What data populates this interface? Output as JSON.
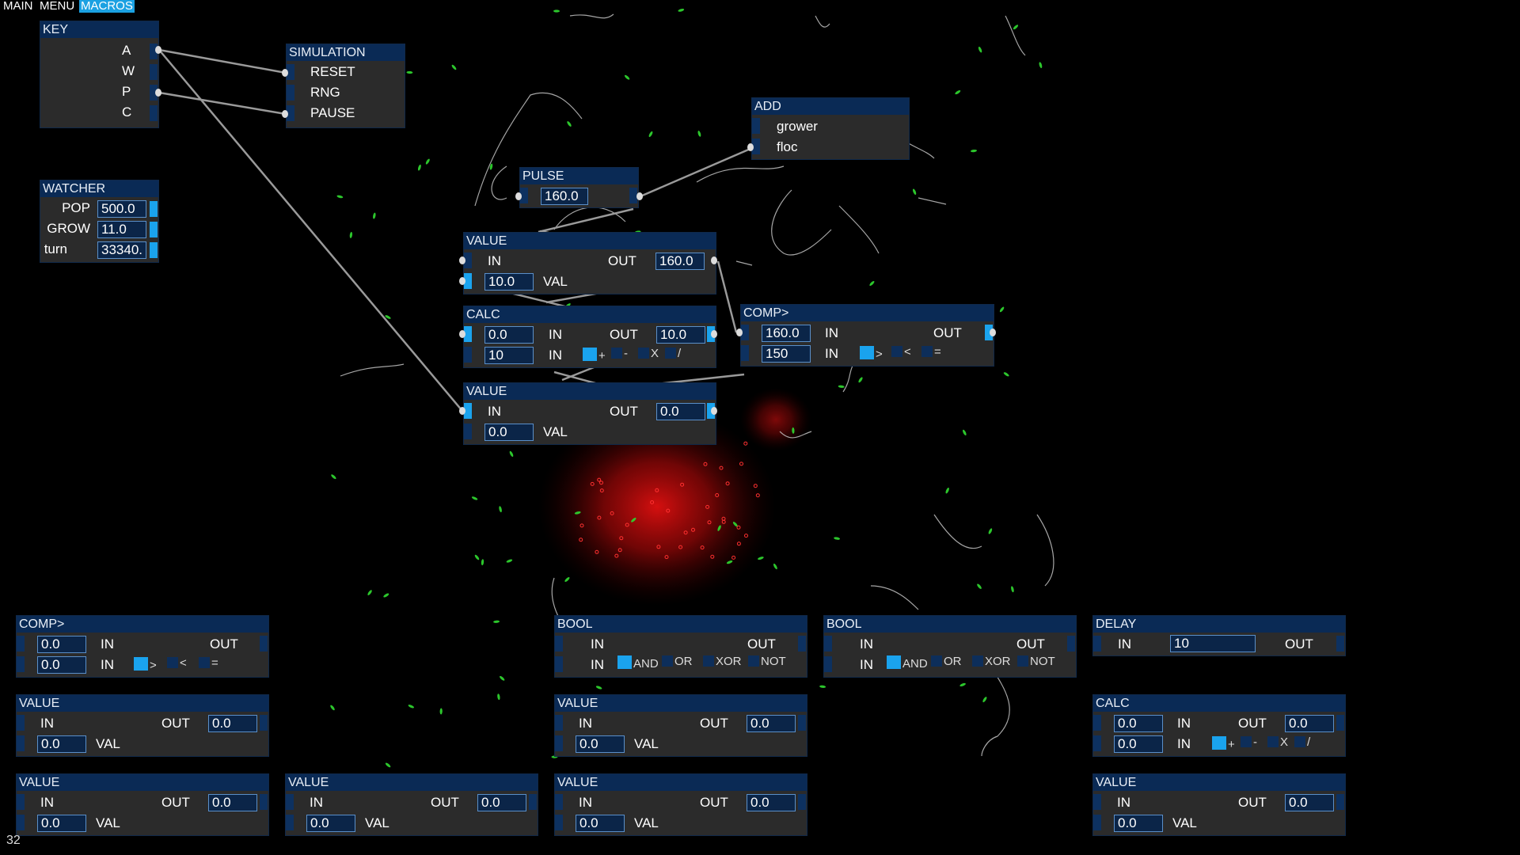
{
  "menu_bar": {
    "items": [
      "MAIN",
      "MENU",
      "MACROS"
    ],
    "active_item": "MACROS"
  },
  "nodes": {
    "key": {
      "title": "KEY",
      "keys": [
        "A",
        "W",
        "P",
        "C"
      ]
    },
    "simulation": {
      "title": "SIMULATION",
      "items": [
        "RESET",
        "RNG",
        "PAUSE"
      ]
    },
    "watcher": {
      "title": "WATCHER",
      "rows": [
        {
          "label": "POP",
          "value": "500.0"
        },
        {
          "label": "GROW",
          "value": "11.0"
        },
        {
          "label": "turn",
          "value": "33340."
        }
      ]
    },
    "pulse": {
      "title": "PULSE",
      "value": "160.0"
    },
    "add": {
      "title": "ADD",
      "items": [
        "grower",
        "floc"
      ]
    },
    "value_top": {
      "title": "VALUE",
      "in": "IN",
      "out": "OUT",
      "out_value": "160.0",
      "val_value": "10.0",
      "val": "VAL"
    },
    "calc_top": {
      "title": "CALC",
      "in1": "0.0",
      "in2": "10",
      "in_label": "IN",
      "out": "OUT",
      "out_value": "10.0",
      "ops": [
        "+",
        "-",
        "X",
        "/"
      ]
    },
    "comp_top": {
      "title": "COMP>",
      "in1": "160.0",
      "in2": "150",
      "in_label": "IN",
      "out": "OUT",
      "ops": [
        ">",
        "<",
        "="
      ]
    },
    "value_mid": {
      "title": "VALUE",
      "in": "IN",
      "out": "OUT",
      "out_value": "0.0",
      "val_value": "0.0",
      "val": "VAL"
    },
    "comp_bl": {
      "title": "COMP>",
      "in1": "0.0",
      "in2": "0.0",
      "in_label": "IN",
      "out": "OUT",
      "ops": [
        ">",
        "<",
        "="
      ]
    },
    "bool_1": {
      "title": "BOOL",
      "in": "IN",
      "out": "OUT",
      "ops": [
        "AND",
        "OR",
        "XOR",
        "NOT"
      ]
    },
    "bool_2": {
      "title": "BOOL",
      "in": "IN",
      "out": "OUT",
      "ops": [
        "AND",
        "OR",
        "XOR",
        "NOT"
      ]
    },
    "delay": {
      "title": "DELAY",
      "in": "IN",
      "value": "10",
      "out": "OUT"
    },
    "value_b1": {
      "title": "VALUE",
      "in": "IN",
      "out": "OUT",
      "out_value": "0.0",
      "val_value": "0.0",
      "val": "VAL"
    },
    "value_b2": {
      "title": "VALUE",
      "in": "IN",
      "out": "OUT",
      "out_value": "0.0",
      "val_value": "0.0",
      "val": "VAL"
    },
    "calc_br": {
      "title": "CALC",
      "in1": "0.0",
      "in2": "0.0",
      "in_label": "IN",
      "out": "OUT",
      "out_value": "0.0",
      "ops": [
        "+",
        "-",
        "X",
        "/"
      ]
    },
    "value_c1": {
      "title": "VALUE",
      "in": "IN",
      "out": "OUT",
      "out_value": "0.0",
      "val_value": "0.0",
      "val": "VAL"
    },
    "value_c2": {
      "title": "VALUE",
      "in": "IN",
      "out": "OUT",
      "out_value": "0.0",
      "val_value": "0.0",
      "val": "VAL"
    },
    "value_c3": {
      "title": "VALUE",
      "in": "IN",
      "out": "OUT",
      "out_value": "0.0",
      "val_value": "0.0",
      "val": "VAL"
    },
    "value_c4": {
      "title": "VALUE",
      "in": "IN",
      "out": "OUT",
      "out_value": "0.0",
      "val_value": "0.0",
      "val": "VAL"
    }
  },
  "status": {
    "fps": "32"
  },
  "colors": {
    "accent": "#1aa3ee",
    "header": "#0a2a55",
    "panel": "#2b2b2b",
    "wire": "#9a9a9a",
    "organism": "#2fd12f",
    "blob": "#d41010"
  }
}
